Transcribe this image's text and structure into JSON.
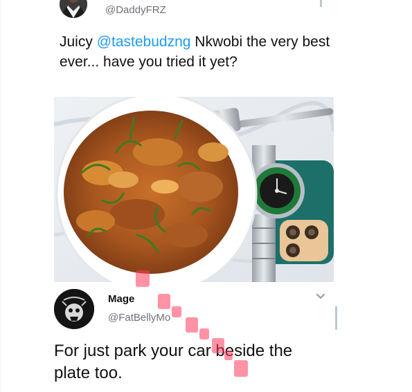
{
  "top_tweet": {
    "handle": "@DaddyFRZ",
    "text_prefix": "Juicy ",
    "mention": "@tastebudzng",
    "text_suffix": " Nkwobi the very best ever... have you tried it yet?"
  },
  "photo": {
    "subject": "nkwobi-bowl-with-fork-watch-phone"
  },
  "reply": {
    "name": "Mage",
    "handle": "@FatBellyMo",
    "text": "For just park your car beside the plate too."
  },
  "colors": {
    "mention": "#1d9bf0",
    "muted": "#6b7178",
    "thread_line": "#b9c8d6",
    "watermark": "#ff3b5c"
  },
  "icons": {
    "chevron": "chevron-down-icon"
  }
}
